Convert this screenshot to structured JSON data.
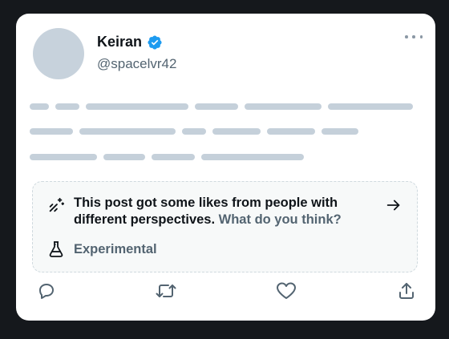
{
  "post": {
    "author": {
      "display_name": "Keiran",
      "handle": "@spacelvr42",
      "verified": true
    },
    "more_icon": "more-horizontal-icon",
    "body_placeholder_lines": 3
  },
  "prompt": {
    "icon": "sparkle-icon",
    "text_bold": "This post got some likes from people with different perspectives.",
    "link_text": "What do you think?",
    "arrow_icon": "arrow-right-icon",
    "tag_icon": "flask-icon",
    "tag_label": "Experimental"
  },
  "actions": [
    {
      "name": "reply",
      "icon": "reply-icon"
    },
    {
      "name": "repost",
      "icon": "repost-icon"
    },
    {
      "name": "like",
      "icon": "heart-icon"
    },
    {
      "name": "share",
      "icon": "share-icon"
    }
  ],
  "colors": {
    "verified_blue": "#1d9bf0",
    "placeholder_gray": "#c5d0da",
    "muted_text": "#536471",
    "page_background": "#15181c"
  }
}
